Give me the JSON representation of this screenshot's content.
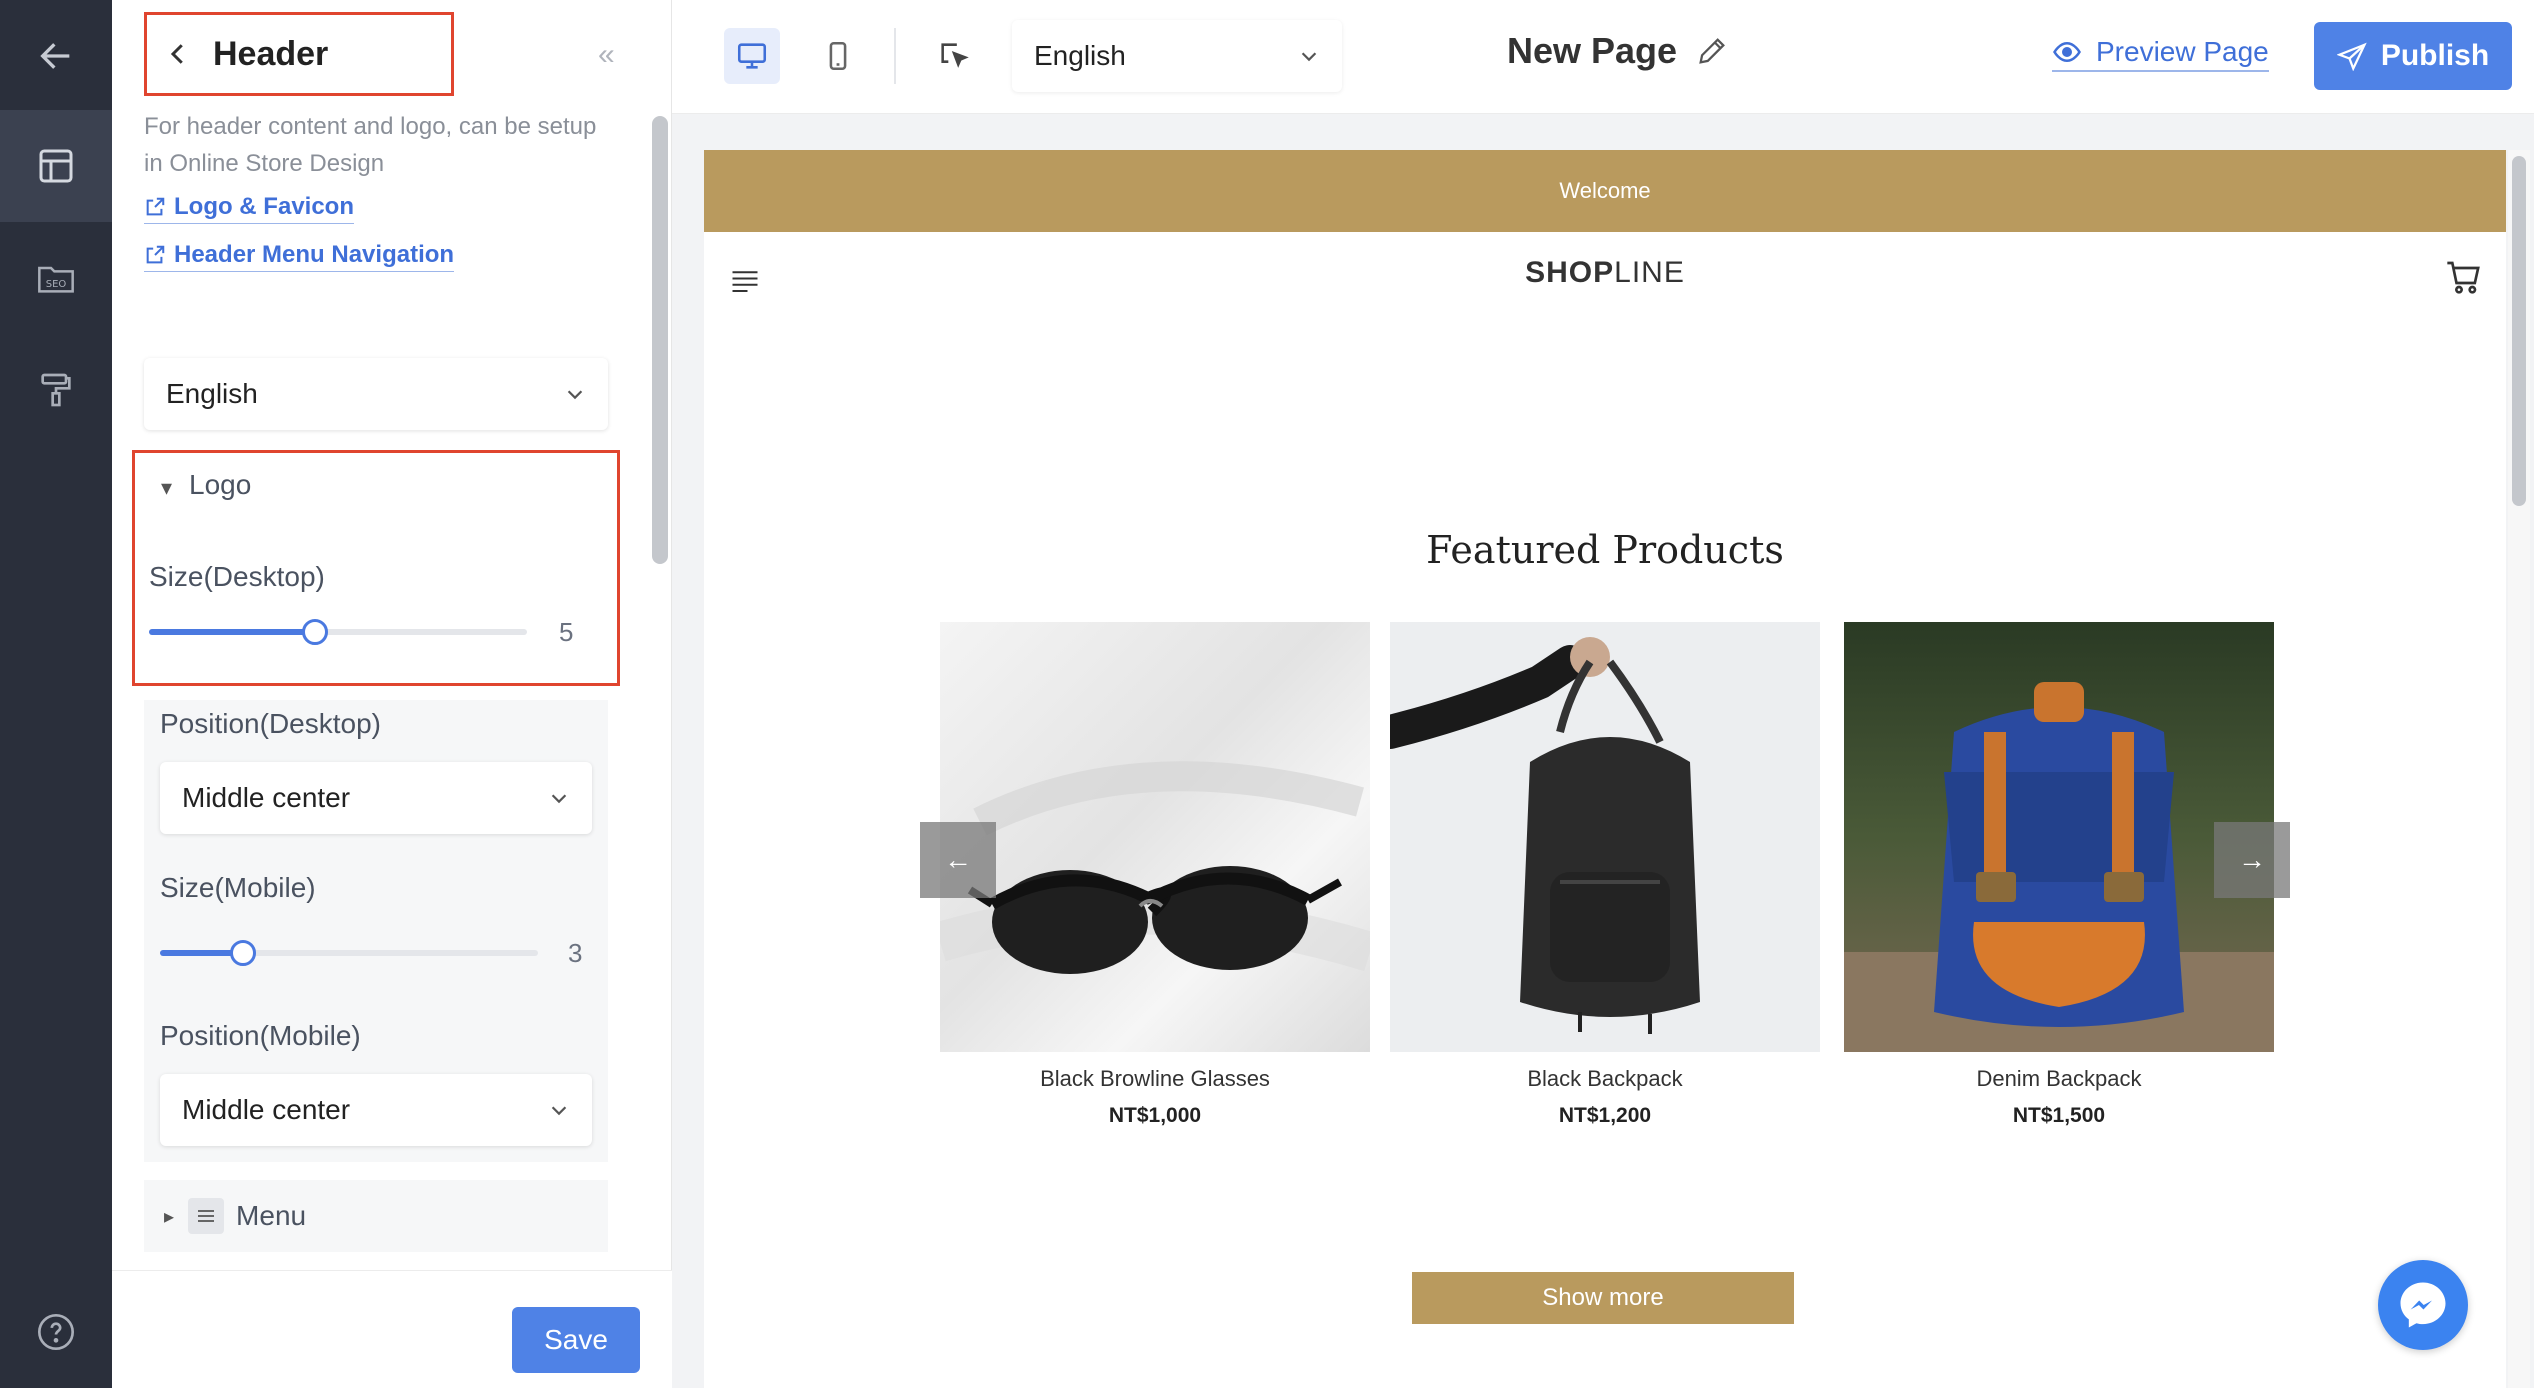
{
  "rail": {
    "items": [
      {
        "name": "back-arrow-icon"
      },
      {
        "name": "layout-icon"
      },
      {
        "name": "seo-icon",
        "label": "SEO"
      },
      {
        "name": "paint-roller-icon"
      },
      {
        "name": "help-icon"
      }
    ]
  },
  "panel": {
    "title": "Header",
    "description": "For header content and logo, can be setup in Online Store Design",
    "links": [
      "Logo & Favicon",
      "Header Menu Navigation"
    ],
    "language": "English",
    "logo_section": "Logo",
    "size_desktop_label": "Size(Desktop)",
    "size_desktop_value": "5",
    "size_desktop_fraction": 0.44,
    "position_desktop_label": "Position(Desktop)",
    "position_desktop_value": "Middle center",
    "size_mobile_label": "Size(Mobile)",
    "size_mobile_value": "3",
    "size_mobile_fraction": 0.22,
    "position_mobile_label": "Position(Mobile)",
    "position_mobile_value": "Middle center",
    "menu_section": "Menu",
    "save_label": "Save"
  },
  "toolbar": {
    "language": "English",
    "page_title": "New Page",
    "preview_label": "Preview Page",
    "publish_label": "Publish"
  },
  "preview": {
    "announcement": "Welcome",
    "logo_bold": "SHOP",
    "logo_light": "LINE",
    "section_title": "Featured Products",
    "products": [
      {
        "name": "Black Browline Glasses",
        "price": "NT$1,000"
      },
      {
        "name": "Black Backpack",
        "price": "NT$1,200"
      },
      {
        "name": "Denim Backpack",
        "price": "NT$1,500"
      }
    ],
    "show_more": "Show more"
  },
  "colors": {
    "accent": "#4f82e6",
    "brand_gold": "#b99a5e",
    "rail": "#2a2f3b",
    "highlight": "#e0452f"
  }
}
